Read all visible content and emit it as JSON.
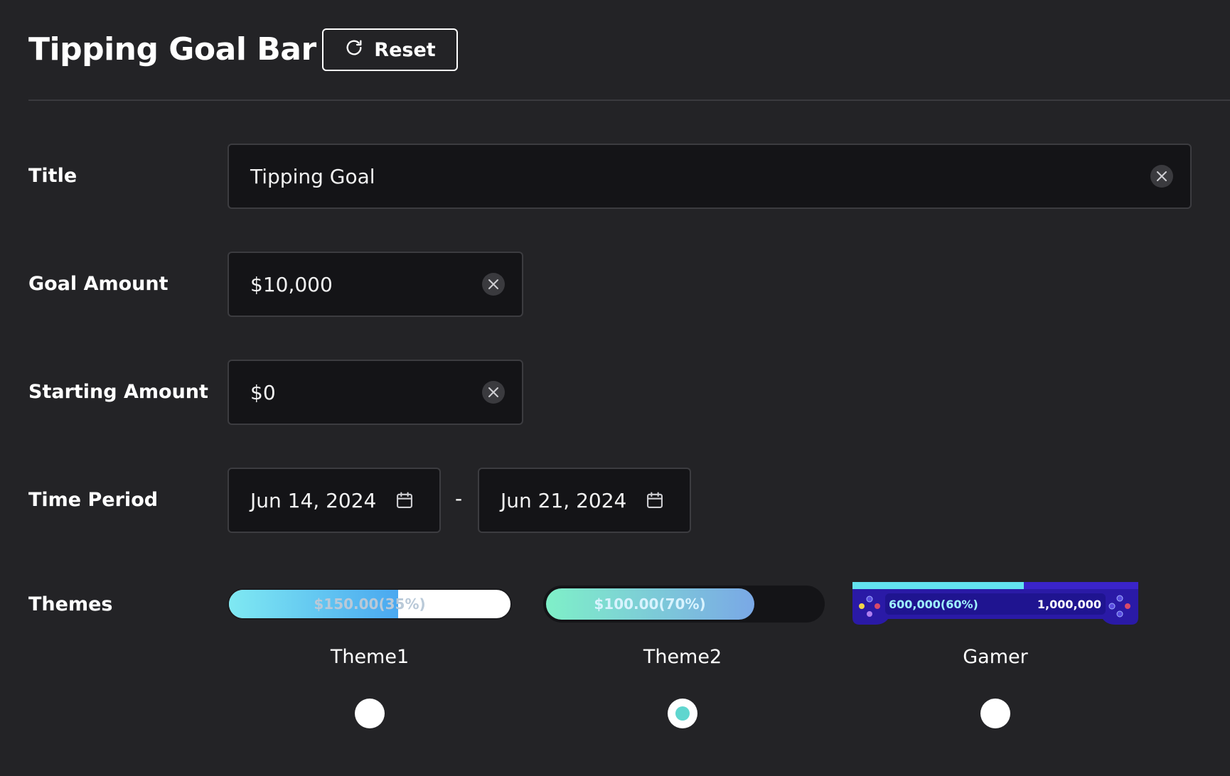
{
  "header": {
    "title": "Tipping Goal Bar",
    "reset_label": "Reset"
  },
  "form": {
    "title": {
      "label": "Title",
      "value": "Tipping Goal"
    },
    "goal_amount": {
      "label": "Goal Amount",
      "value": "$10,000"
    },
    "starting_amount": {
      "label": "Starting Amount",
      "value": "$0"
    },
    "time_period": {
      "label": "Time Period",
      "start": "Jun 14, 2024",
      "separator": "-",
      "end": "Jun 21, 2024"
    }
  },
  "themes": {
    "label": "Themes",
    "selected": "Theme2",
    "items": [
      {
        "name": "Theme1",
        "preview_text": "$150.00(35%)",
        "fill_fraction": 0.6,
        "colors": [
          "#7fe9f2",
          "#4aa8f0"
        ]
      },
      {
        "name": "Theme2",
        "preview_text": "$100.00(70%)",
        "fill_fraction": 0.74,
        "colors": [
          "#7ff0c8",
          "#7aa8e6"
        ]
      },
      {
        "name": "Gamer",
        "preview_current": "600,000(60%)",
        "preview_goal": "1,000,000",
        "fill_fraction": 0.6,
        "colors": [
          "#62e3f0",
          "#3a24c9"
        ]
      }
    ]
  },
  "icons": {
    "reset": "refresh-icon",
    "clear": "close-icon",
    "date": "calendar-icon"
  }
}
